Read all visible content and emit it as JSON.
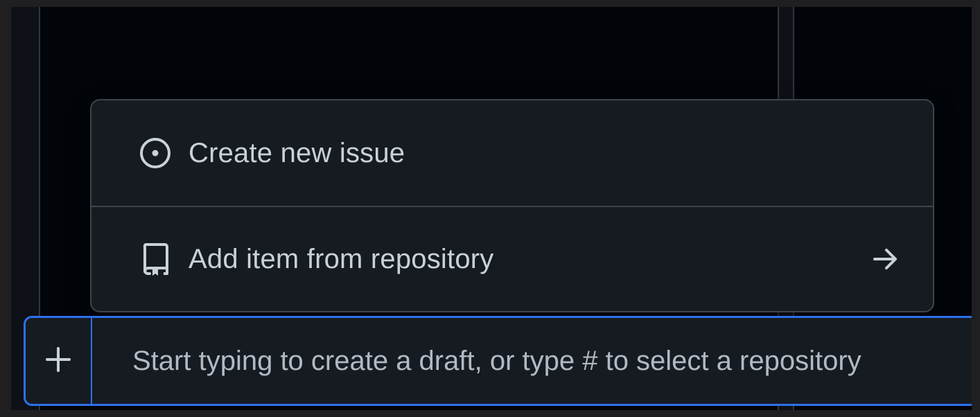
{
  "menu": {
    "items": [
      {
        "label": "Create new issue",
        "icon": "issue-opened-icon"
      },
      {
        "label": "Add item from repository",
        "icon": "repo-icon",
        "trailing_icon": "arrow-right-icon"
      }
    ]
  },
  "draft": {
    "add_icon": "plus-icon",
    "placeholder": "Start typing to create a draft, or type # to select a repository",
    "value": ""
  },
  "colors": {
    "accent": "#2f6feb",
    "text": "#c9d1d9",
    "menu_bg": "#161b22",
    "border": "#3d444d",
    "page_bg": "#010409"
  }
}
